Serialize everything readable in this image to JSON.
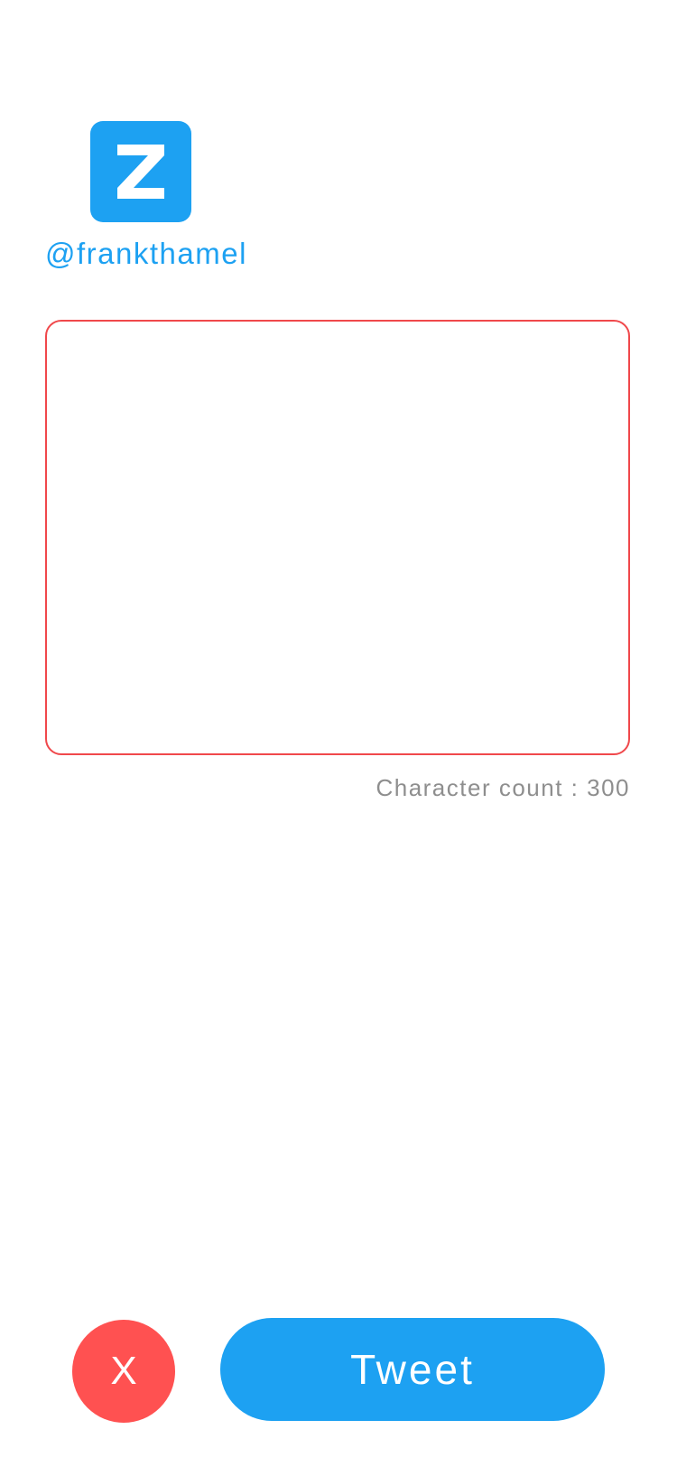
{
  "header": {
    "logo_icon": "z-logo-icon",
    "username": "@frankthamel"
  },
  "compose": {
    "text_value": "",
    "placeholder": ""
  },
  "footer_info": {
    "character_count_text": "Character count : 300"
  },
  "actions": {
    "cancel_label": "X",
    "tweet_label": "Tweet"
  },
  "colors": {
    "brand_blue": "#1DA1F2",
    "cancel_red": "#FF5151",
    "input_border_red": "#F0484B",
    "count_gray": "#8E8E8E"
  }
}
